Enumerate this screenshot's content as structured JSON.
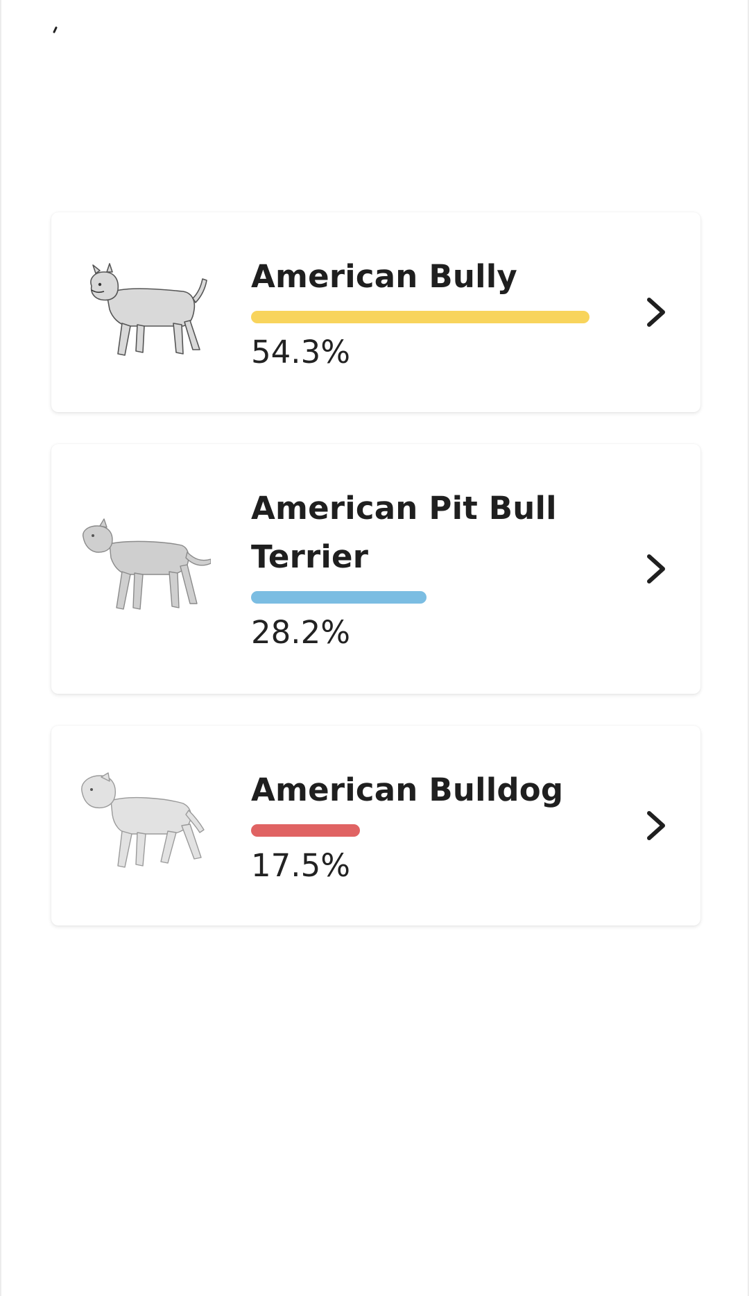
{
  "breeds": [
    {
      "name": "American Bully",
      "percent_label": "54.3%",
      "percent": 54.3,
      "bar_color": "#f8d45c",
      "icon": "american-bully-dog-icon"
    },
    {
      "name": "American Pit Bull Terrier",
      "percent_label": "28.2%",
      "percent": 28.2,
      "bar_color": "#7bbde2",
      "icon": "pit-bull-terrier-dog-icon"
    },
    {
      "name": "American Bulldog",
      "percent_label": "17.5%",
      "percent": 17.5,
      "bar_color": "#e06363",
      "icon": "american-bulldog-dog-icon"
    }
  ],
  "chevron_icon": "chevron-right-icon",
  "colors": {
    "text": "#222222",
    "background": "#ffffff"
  }
}
